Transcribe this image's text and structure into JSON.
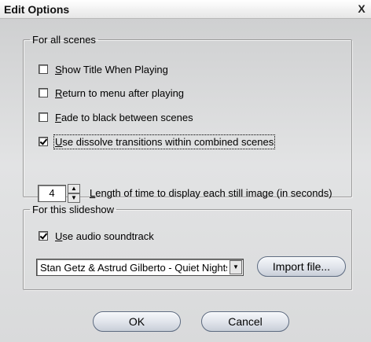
{
  "window": {
    "title": "Edit Options",
    "close_glyph": "X"
  },
  "group_all": {
    "legend": "For all scenes",
    "options": [
      {
        "label": "Show Title When Playing",
        "checked": false
      },
      {
        "label": "Return to menu after playing",
        "checked": false
      },
      {
        "label": "Fade to black between scenes",
        "checked": false
      },
      {
        "label": "Use dissolve transitions within combined scenes",
        "checked": true
      }
    ],
    "still_duration": {
      "value": "4",
      "label": "Length of time to display each still image (in seconds)"
    }
  },
  "group_slideshow": {
    "legend": "For this slideshow",
    "audio": {
      "label": "Use audio soundtrack",
      "checked": true
    },
    "track": {
      "selected": "Stan Getz & Astrud Gilberto - Quiet Nights"
    },
    "import_label": "Import file..."
  },
  "buttons": {
    "ok": "OK",
    "cancel": "Cancel"
  },
  "icons": {
    "spin_up": "up-arrow-icon",
    "spin_down": "down-arrow-icon",
    "dropdown": "chevron-down-icon"
  }
}
